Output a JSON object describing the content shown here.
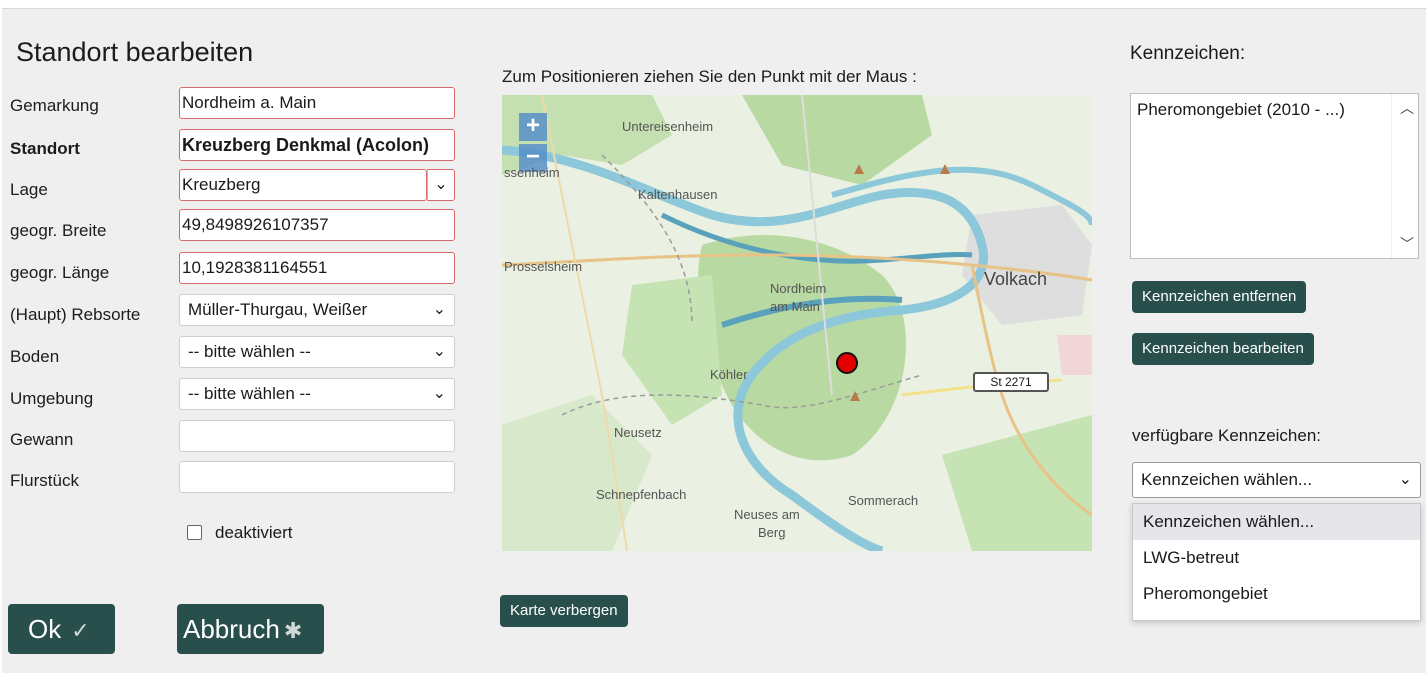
{
  "dialog": {
    "title": "Standort bearbeiten"
  },
  "form": {
    "gemarkung": {
      "label": "Gemarkung",
      "value": "Nordheim a. Main"
    },
    "standort": {
      "label": "Standort",
      "value": "Kreuzberg Denkmal (Acolon)"
    },
    "lage": {
      "label": "Lage",
      "value": "Kreuzberg"
    },
    "breite": {
      "label": "geogr. Breite",
      "value": "49,8498926107357"
    },
    "laenge": {
      "label": "geogr. Länge",
      "value": "10,1928381164551"
    },
    "rebsorte": {
      "label": "(Haupt) Rebsorte",
      "value": "Müller-Thurgau, Weißer"
    },
    "boden": {
      "label": "Boden",
      "value": "-- bitte wählen --"
    },
    "umgebung": {
      "label": "Umgebung",
      "value": "-- bitte wählen --"
    },
    "gewann": {
      "label": "Gewann",
      "value": ""
    },
    "flurstueck": {
      "label": "Flurstück",
      "value": ""
    },
    "deaktiviert": {
      "label": "deaktiviert",
      "checked": false
    }
  },
  "buttons": {
    "ok": "Ok",
    "abbruch": "Abbruch",
    "karte_verbergen": "Karte verbergen",
    "kennzeichen_entfernen": "Kennzeichen entfernen",
    "kennzeichen_bearbeiten": "Kennzeichen bearbeiten"
  },
  "map": {
    "caption": "Zum Positionieren ziehen Sie den Punkt mit der Maus :",
    "zoom_in": "+",
    "zoom_out": "−",
    "places": {
      "untereisenheim": "Untereisenheim",
      "sseheim": "ssenheim",
      "kaltenhausen": "Kaltenhausen",
      "prosselsheim": "Prosselsheim",
      "nordheim1": "Nordheim",
      "nordheim2": "am Main",
      "volkach": "Volkach",
      "koehler": "Köhler",
      "neusetz": "Neusetz",
      "schnepfenbach": "Schnepfenbach",
      "neuses1": "Neuses am",
      "neuses2": "Berg",
      "sommerach": "Sommerach"
    },
    "road": "St 2271",
    "colors": {
      "marker": "#e30000",
      "river": "#6ab0c8",
      "forest": "#b9d9a2"
    }
  },
  "kennzeichen": {
    "title": "Kennzeichen:",
    "assigned": [
      "Pheromongebiet (2010 - ...)"
    ],
    "available_label": "verfügbare Kennzeichen:",
    "available_selected": "Kennzeichen wählen...",
    "options": [
      "Kennzeichen wählen...",
      "LWG-betreut",
      "Pheromongebiet"
    ]
  },
  "icons": {
    "ok": "check-icon",
    "abbruch": "cancel-star-icon",
    "dropdown": "chevron-down-icon",
    "scroll_up": "chevron-up-icon"
  }
}
